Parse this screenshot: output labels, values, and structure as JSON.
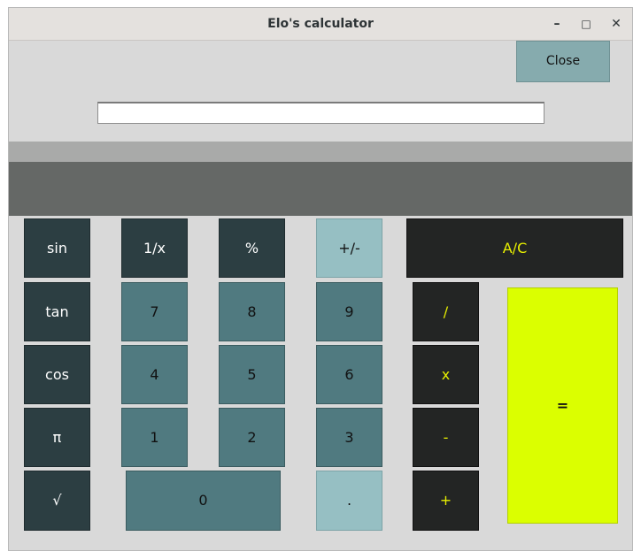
{
  "window": {
    "title": "Elo's calculator"
  },
  "controls": {
    "minimize": "–",
    "maximize": "□",
    "close": "✕"
  },
  "top": {
    "close_label": "Close"
  },
  "input": {
    "value": ""
  },
  "display": {
    "value": ""
  },
  "buttons": {
    "sin": "sin",
    "tan": "tan",
    "cos": "cos",
    "pi": "π",
    "sqrt": "√",
    "reciprocal": "1/x",
    "percent": "%",
    "sign": "+/-",
    "clear": "A/C",
    "seven": "7",
    "eight": "8",
    "nine": "9",
    "four": "4",
    "five": "5",
    "six": "6",
    "one": "1",
    "two": "2",
    "three": "3",
    "zero": "0",
    "dot": ".",
    "divide": "/",
    "multiply": "x",
    "minus": "-",
    "plus": "+",
    "equals": "="
  }
}
